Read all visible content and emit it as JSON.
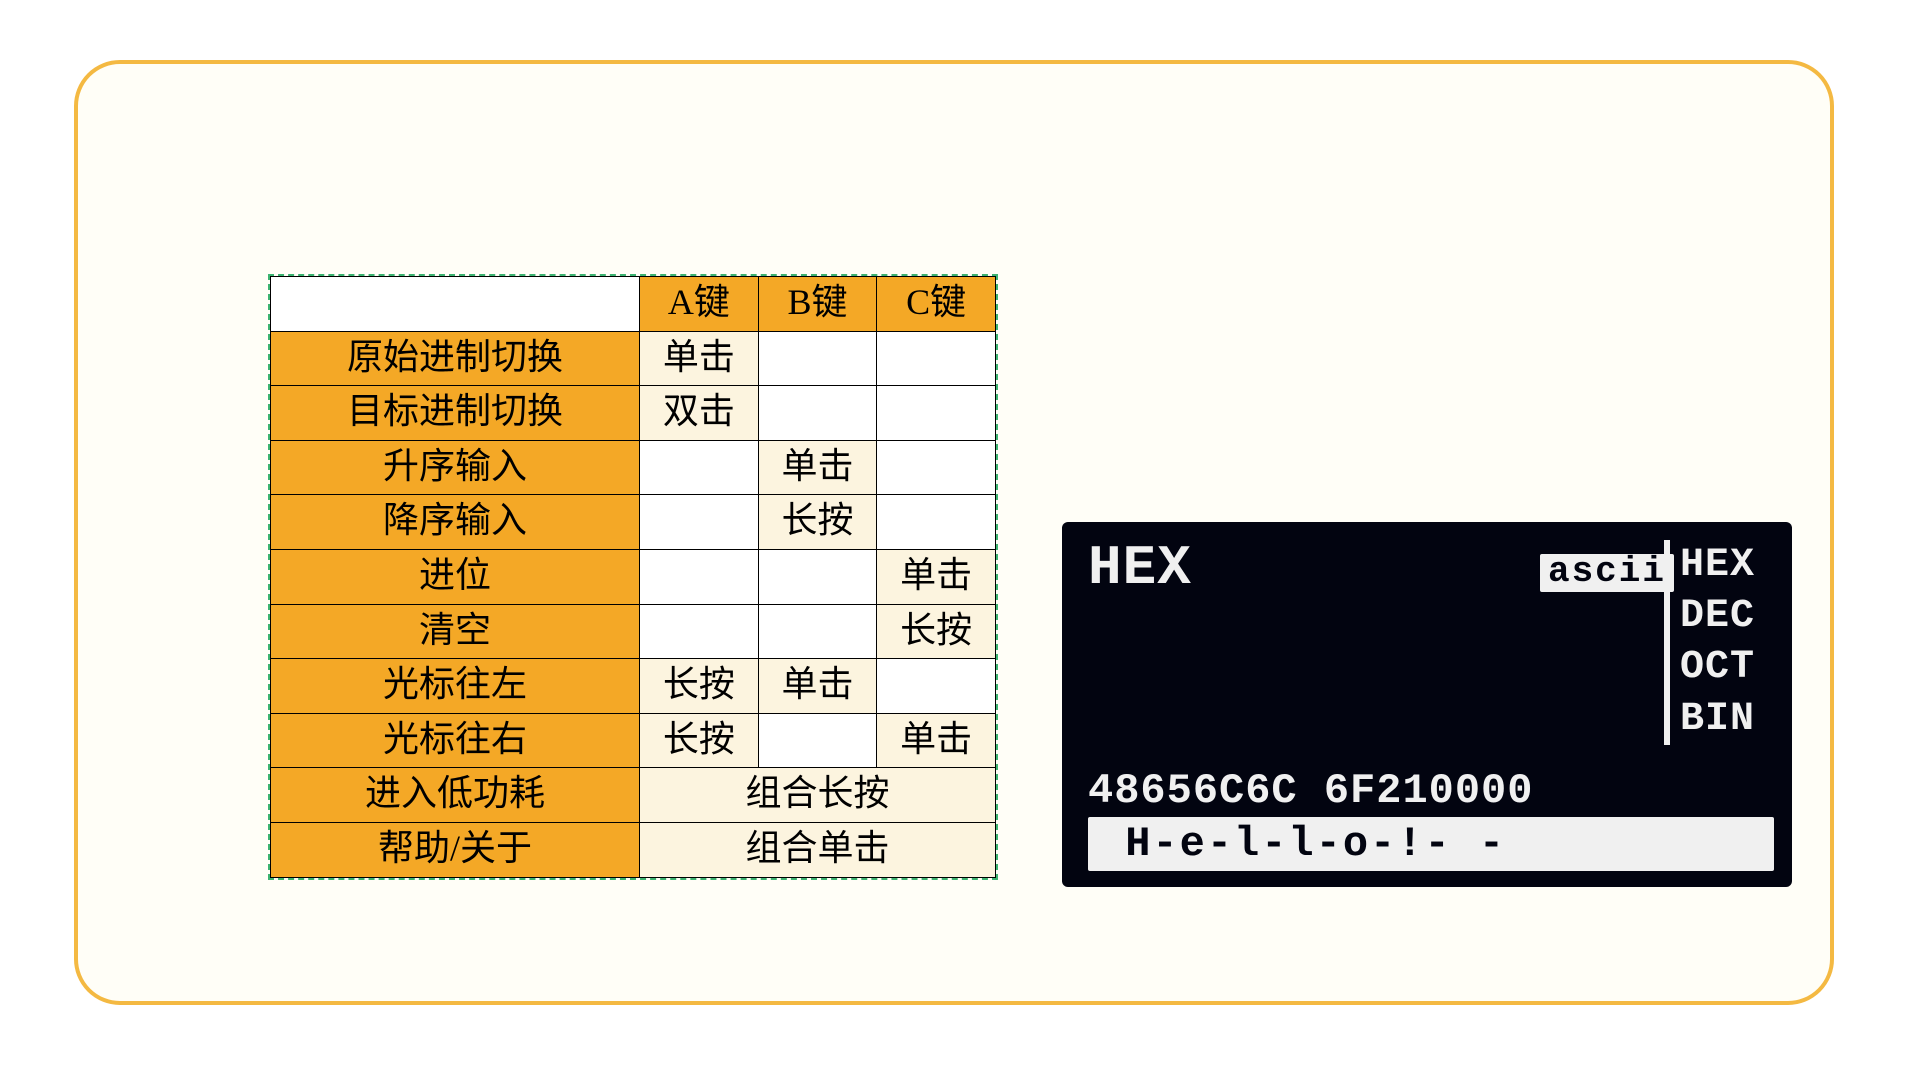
{
  "table": {
    "headers": {
      "a": "A键",
      "b": "B键",
      "c": "C键"
    },
    "rows": [
      {
        "label": "原始进制切换",
        "a": "单击",
        "b": "",
        "c": "",
        "span": 0
      },
      {
        "label": "目标进制切换",
        "a": "双击",
        "b": "",
        "c": "",
        "span": 0
      },
      {
        "label": "升序输入",
        "a": "",
        "b": "单击",
        "c": "",
        "span": 0
      },
      {
        "label": "降序输入",
        "a": "",
        "b": "长按",
        "c": "",
        "span": 0
      },
      {
        "label": "进位",
        "a": "",
        "b": "",
        "c": "单击",
        "span": 0
      },
      {
        "label": "清空",
        "a": "",
        "b": "",
        "c": "长按",
        "span": 0
      },
      {
        "label": "光标往左",
        "a": "长按",
        "b": "单击",
        "c": "",
        "span": 0
      },
      {
        "label": "光标往右",
        "a": "长按",
        "b": "",
        "c": "单击",
        "span": 0
      },
      {
        "label": "进入低功耗",
        "combo": "组合长按",
        "span": 3
      },
      {
        "label": "帮助/关于",
        "combo": "组合单击",
        "span": 3
      }
    ]
  },
  "lcd": {
    "title": "HEX",
    "ascii_badge": "ascii",
    "hex": "48656C6C 6F210000",
    "side": [
      "HEX",
      "DEC",
      "OCT",
      "BIN"
    ],
    "decoded": " H-e-l-l-o-!- -"
  }
}
